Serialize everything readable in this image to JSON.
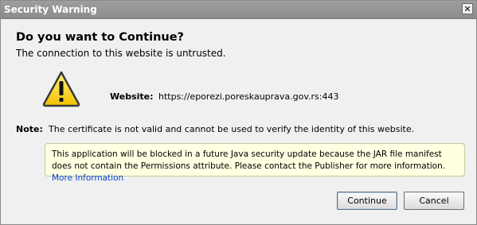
{
  "window": {
    "title": "Security Warning",
    "close_glyph": "✕"
  },
  "dialog": {
    "heading": "Do you want to Continue?",
    "subheading": "The connection to this website is untrusted.",
    "icon": "warning-triangle-icon",
    "website_label": "Website:",
    "website_value": "https://eporezi.poreskauprava.gov.rs:443",
    "note_label": "Note:",
    "note_text": "The certificate is not valid and cannot be used to verify the identity of this website.",
    "info_message": "This application will be blocked in a future Java security update because the JAR file manifest does not contain the Permissions attribute. Please contact the Publisher for more information.",
    "info_link": "More Information"
  },
  "buttons": {
    "continue_label": "Continue",
    "cancel_label": "Cancel"
  },
  "colors": {
    "titlebar": "#949494",
    "info_background": "#ffffe1",
    "link": "#0a46c8",
    "warning_yellow": "#f7d31b"
  }
}
